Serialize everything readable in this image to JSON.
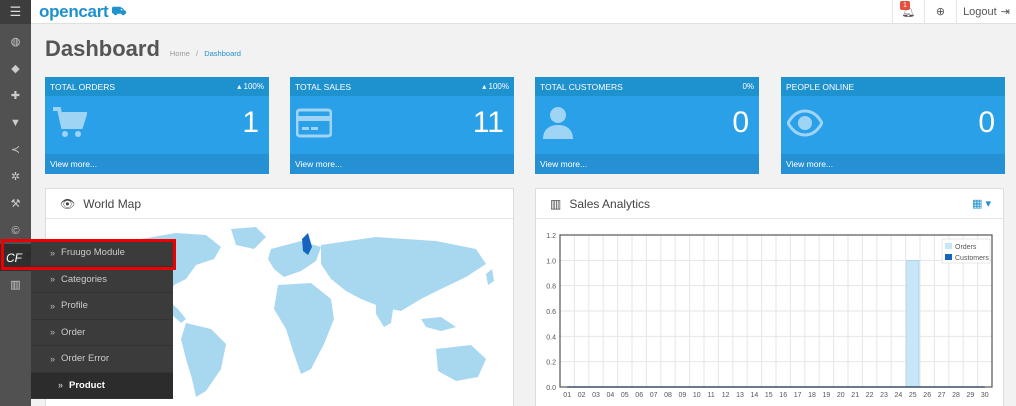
{
  "header": {
    "logo": "opencart",
    "notification_count": "1",
    "logout_label": "Logout"
  },
  "page": {
    "title": "Dashboard",
    "breadcrumb": [
      "Home",
      "/",
      "Dashboard"
    ]
  },
  "sidebar": {
    "active_item": "CF"
  },
  "flyout": {
    "items": [
      "Fruugo Module",
      "Categories",
      "Profile",
      "Order",
      "Order Error",
      "Product"
    ]
  },
  "tiles": [
    {
      "title": "TOTAL ORDERS",
      "change": "100%",
      "value": "1",
      "footer": "View more...",
      "icon": "cart-icon"
    },
    {
      "title": "TOTAL SALES",
      "change": "100%",
      "value": "11",
      "footer": "View more...",
      "icon": "credit-card-icon"
    },
    {
      "title": "TOTAL CUSTOMERS",
      "change": "0%",
      "value": "0",
      "footer": "View more...",
      "icon": "user-icon"
    },
    {
      "title": "PEOPLE ONLINE",
      "change": "",
      "value": "0",
      "footer": "View more...",
      "icon": "eye-icon"
    }
  ],
  "panels": {
    "map_title": "World Map",
    "analytics_title": "Sales Analytics"
  },
  "chart_data": {
    "type": "bar",
    "categories": [
      "01",
      "02",
      "03",
      "04",
      "05",
      "06",
      "07",
      "08",
      "09",
      "10",
      "11",
      "12",
      "13",
      "14",
      "15",
      "16",
      "17",
      "18",
      "19",
      "20",
      "21",
      "22",
      "23",
      "24",
      "25",
      "26",
      "27",
      "28",
      "29",
      "30"
    ],
    "series": [
      {
        "name": "Orders",
        "values": [
          0,
          0,
          0,
          0,
          0,
          0,
          0,
          0,
          0,
          0,
          0,
          0,
          0,
          0,
          0,
          0,
          0,
          0,
          0,
          0,
          0,
          0,
          0,
          0,
          1,
          0,
          0,
          0,
          0,
          0
        ]
      },
      {
        "name": "Customers",
        "values": [
          0,
          0,
          0,
          0,
          0,
          0,
          0,
          0,
          0,
          0,
          0,
          0,
          0,
          0,
          0,
          0,
          0,
          0,
          0,
          0,
          0,
          0,
          0,
          0,
          0,
          0,
          0,
          0,
          0,
          0
        ]
      }
    ],
    "yticks": [
      "0.0",
      "0.2",
      "0.4",
      "0.6",
      "0.8",
      "1.0",
      "1.2"
    ],
    "ylim": [
      0,
      1.2
    ],
    "grid": true,
    "legend": "top-right",
    "colors": {
      "Orders": "#c7e6f7",
      "Customers": "#1565c0"
    }
  }
}
